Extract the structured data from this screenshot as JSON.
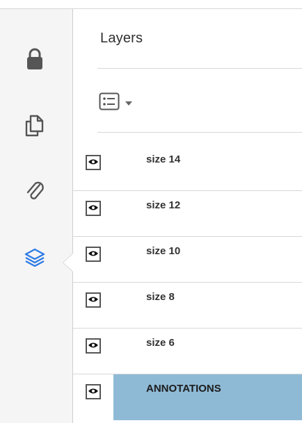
{
  "colors": {
    "rail_bg": "#f5f5f5",
    "icon_gray": "#555555",
    "active_icon_blue": "#2c7be5",
    "selected_row_bg": "#8ebad6"
  },
  "rail": {
    "items": [
      {
        "icon": "lock-icon",
        "active": false
      },
      {
        "icon": "pages-icon",
        "active": false
      },
      {
        "icon": "attachment-icon",
        "active": false
      },
      {
        "icon": "layers-icon",
        "active": true
      }
    ]
  },
  "panel": {
    "title": "Layers",
    "options_icon": "list-options-icon"
  },
  "layers": [
    {
      "name": "size 14",
      "visible": true,
      "selected": false
    },
    {
      "name": "size 12",
      "visible": true,
      "selected": false
    },
    {
      "name": "size 10",
      "visible": true,
      "selected": false
    },
    {
      "name": "size 8",
      "visible": true,
      "selected": false
    },
    {
      "name": "size 6",
      "visible": true,
      "selected": false
    },
    {
      "name": "ANNOTATIONS",
      "visible": true,
      "selected": true
    }
  ]
}
